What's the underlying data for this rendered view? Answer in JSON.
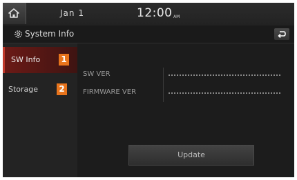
{
  "status_bar": {
    "date": "Jan 1",
    "time": "12:00",
    "ampm": "AM"
  },
  "header": {
    "title": "System Info"
  },
  "sidebar": {
    "items": [
      {
        "label": "SW Info",
        "callout": "1",
        "active": true
      },
      {
        "label": "Storage",
        "callout": "2",
        "active": false
      }
    ]
  },
  "main": {
    "rows": [
      {
        "label": "SW VER",
        "value": ""
      },
      {
        "label": "FIRMWARE VER",
        "value": ""
      }
    ],
    "update_label": "Update"
  },
  "icons": {
    "home": "home-icon",
    "settings": "gear-icon",
    "back": "back-arrow-icon"
  },
  "colors": {
    "active_tab": "#6b1a16",
    "callout": "#e8741c",
    "background": "#1d1d1d"
  }
}
